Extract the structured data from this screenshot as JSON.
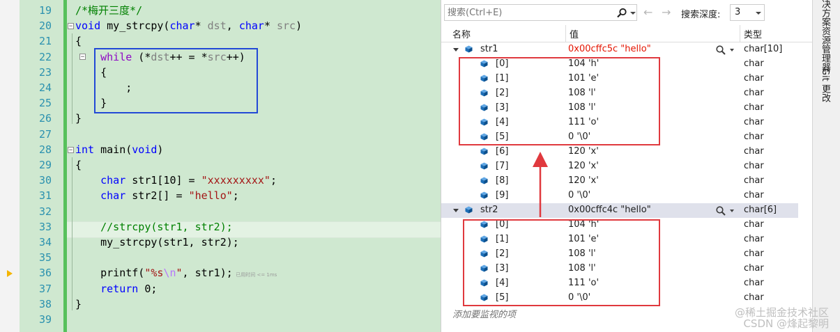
{
  "editor": {
    "first_line": 19,
    "lines": [
      {
        "num": "19",
        "parts": [
          {
            "t": "/*梅开三度*/",
            "c": "cm"
          }
        ]
      },
      {
        "num": "20",
        "parts": [
          {
            "t": "void",
            "c": "kw"
          },
          {
            "t": " my_strcpy(",
            "c": ""
          },
          {
            "t": "char",
            "c": "kw"
          },
          {
            "t": "* ",
            "c": ""
          },
          {
            "t": "dst",
            "c": "par"
          },
          {
            "t": ", ",
            "c": ""
          },
          {
            "t": "char",
            "c": "kw"
          },
          {
            "t": "* ",
            "c": ""
          },
          {
            "t": "src",
            "c": "par"
          },
          {
            "t": ")",
            "c": ""
          }
        ]
      },
      {
        "num": "21",
        "parts": [
          {
            "t": "{",
            "c": ""
          }
        ]
      },
      {
        "num": "22",
        "parts": [
          {
            "t": "    ",
            "c": ""
          },
          {
            "t": "while",
            "c": "kw2"
          },
          {
            "t": " (*",
            "c": ""
          },
          {
            "t": "dst",
            "c": "par"
          },
          {
            "t": "++ = *",
            "c": ""
          },
          {
            "t": "src",
            "c": "par"
          },
          {
            "t": "++)",
            "c": ""
          }
        ]
      },
      {
        "num": "23",
        "parts": [
          {
            "t": "    {",
            "c": ""
          }
        ]
      },
      {
        "num": "24",
        "parts": [
          {
            "t": "        ;",
            "c": ""
          }
        ]
      },
      {
        "num": "25",
        "parts": [
          {
            "t": "    }",
            "c": ""
          }
        ]
      },
      {
        "num": "26",
        "parts": [
          {
            "t": "}",
            "c": ""
          }
        ]
      },
      {
        "num": "27",
        "parts": []
      },
      {
        "num": "28",
        "parts": [
          {
            "t": "int",
            "c": "kw"
          },
          {
            "t": " main(",
            "c": ""
          },
          {
            "t": "void",
            "c": "kw"
          },
          {
            "t": ")",
            "c": ""
          }
        ]
      },
      {
        "num": "29",
        "parts": [
          {
            "t": "{",
            "c": ""
          }
        ]
      },
      {
        "num": "30",
        "parts": [
          {
            "t": "    ",
            "c": ""
          },
          {
            "t": "char",
            "c": "kw"
          },
          {
            "t": " str1[10] = ",
            "c": ""
          },
          {
            "t": "\"xxxxxxxxx\"",
            "c": "str"
          },
          {
            "t": ";",
            "c": ""
          }
        ]
      },
      {
        "num": "31",
        "parts": [
          {
            "t": "    ",
            "c": ""
          },
          {
            "t": "char",
            "c": "kw"
          },
          {
            "t": " str2[] = ",
            "c": ""
          },
          {
            "t": "\"hello\"",
            "c": "str"
          },
          {
            "t": ";",
            "c": ""
          }
        ]
      },
      {
        "num": "32",
        "parts": []
      },
      {
        "num": "33",
        "parts": [
          {
            "t": "    ",
            "c": ""
          },
          {
            "t": "//strcpy(str1, str2);",
            "c": "cm"
          }
        ]
      },
      {
        "num": "34",
        "parts": [
          {
            "t": "    my_strcpy(str1, str2);",
            "c": ""
          }
        ]
      },
      {
        "num": "35",
        "parts": []
      },
      {
        "num": "36",
        "parts": [
          {
            "t": "    printf(",
            "c": ""
          },
          {
            "t": "\"%s",
            "c": "str"
          },
          {
            "t": "\\n",
            "c": "esc"
          },
          {
            "t": "\"",
            "c": "str"
          },
          {
            "t": ", str1);",
            "c": ""
          },
          {
            "t": "  已用时间 <= 1ms",
            "c": "timehint"
          }
        ]
      },
      {
        "num": "37",
        "parts": [
          {
            "t": "    ",
            "c": ""
          },
          {
            "t": "return",
            "c": "kw"
          },
          {
            "t": " 0;",
            "c": ""
          }
        ]
      },
      {
        "num": "38",
        "parts": [
          {
            "t": "}",
            "c": ""
          }
        ]
      },
      {
        "num": "39",
        "parts": []
      }
    ]
  },
  "watch": {
    "search_placeholder": "搜索(Ctrl+E)",
    "depth_label": "搜索深度:",
    "depth_value": "3",
    "columns": {
      "name": "名称",
      "value": "值",
      "type": "类型"
    },
    "rows": [
      {
        "level": 0,
        "name": "str1",
        "value": "0x00cffc5c \"hello\"",
        "type": "char[10]",
        "red": true,
        "expanded": true,
        "mag": true,
        "selected": false
      },
      {
        "level": 1,
        "name": "[0]",
        "value": "104 'h'",
        "type": "char"
      },
      {
        "level": 1,
        "name": "[1]",
        "value": "101 'e'",
        "type": "char"
      },
      {
        "level": 1,
        "name": "[2]",
        "value": "108 'l'",
        "type": "char"
      },
      {
        "level": 1,
        "name": "[3]",
        "value": "108 'l'",
        "type": "char"
      },
      {
        "level": 1,
        "name": "[4]",
        "value": "111 'o'",
        "type": "char"
      },
      {
        "level": 1,
        "name": "[5]",
        "value": "0 '\\0'",
        "type": "char"
      },
      {
        "level": 1,
        "name": "[6]",
        "value": "120 'x'",
        "type": "char"
      },
      {
        "level": 1,
        "name": "[7]",
        "value": "120 'x'",
        "type": "char"
      },
      {
        "level": 1,
        "name": "[8]",
        "value": "120 'x'",
        "type": "char"
      },
      {
        "level": 1,
        "name": "[9]",
        "value": "0 '\\0'",
        "type": "char"
      },
      {
        "level": 0,
        "name": "str2",
        "value": "0x00cffc4c \"hello\"",
        "type": "char[6]",
        "red": false,
        "expanded": true,
        "mag": true,
        "selected": true
      },
      {
        "level": 1,
        "name": "[0]",
        "value": "104 'h'",
        "type": "char"
      },
      {
        "level": 1,
        "name": "[1]",
        "value": "101 'e'",
        "type": "char"
      },
      {
        "level": 1,
        "name": "[2]",
        "value": "108 'l'",
        "type": "char"
      },
      {
        "level": 1,
        "name": "[3]",
        "value": "108 'l'",
        "type": "char"
      },
      {
        "level": 1,
        "name": "[4]",
        "value": "111 'o'",
        "type": "char"
      },
      {
        "level": 1,
        "name": "[5]",
        "value": "0 '\\0'",
        "type": "char"
      }
    ],
    "add_watch": "添加要监视的项"
  },
  "side_panel": {
    "tab1": "解决方案资源管理器",
    "tab2": "Git 更改"
  },
  "watermark": {
    "line1": "@稀土掘金技术社区",
    "line2": "CSDN @烽起黎明"
  },
  "colors": {
    "editor_bg": "#cfe8d0",
    "keyword": "#0000ff",
    "highlight_box": "#2249d6",
    "annotation_red": "#e0393e",
    "value_changed": "#e41400"
  },
  "icons": {
    "search": "magnifier-icon",
    "back": "arrow-left-icon",
    "forward": "arrow-right-icon",
    "variable": "cube-icon",
    "current_statement": "execution-arrow-icon"
  }
}
